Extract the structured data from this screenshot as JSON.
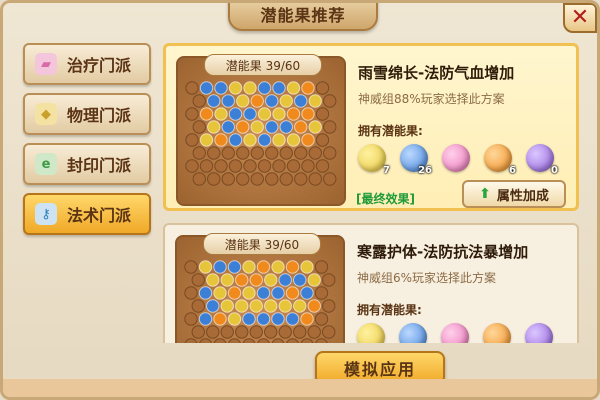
{
  "window": {
    "title": "潜能果推荐",
    "close_label": "✕"
  },
  "sidebar": {
    "items": [
      {
        "label": "治疗门派",
        "icon": "heal-scroll-icon",
        "color": "#d86aa8",
        "active": false
      },
      {
        "label": "物理门派",
        "icon": "physical-emblem-icon",
        "color": "#c9a02a",
        "active": false
      },
      {
        "label": "封印门派",
        "icon": "seal-emblem-icon",
        "color": "#3f9a48",
        "active": false
      },
      {
        "label": "法术门派",
        "icon": "magic-key-icon",
        "color": "#2b7fb8",
        "active": true
      }
    ]
  },
  "cards": [
    {
      "board_label": "潜能果 39/60",
      "title": "雨雪绵长-法防气血增加",
      "subtitle": "神威组88%玩家选择此方案",
      "own_label": "拥有潜能果:",
      "fruits": [
        {
          "icon": "gold-fruit-icon",
          "color": "#e7c53a",
          "count": "7"
        },
        {
          "icon": "blue-fruit-icon",
          "color": "#3c7fd6",
          "count": "26"
        },
        {
          "icon": "pink-fruit-icon",
          "color": "#e86fb4",
          "count": ""
        },
        {
          "icon": "orange-fruit-icon",
          "color": "#f08a1c",
          "count": "6"
        },
        {
          "icon": "purple-fruit-icon",
          "color": "#8d5bd8",
          "count": "0"
        }
      ],
      "final_tag": "[最终效果]",
      "attr_button": "属性加成"
    },
    {
      "board_label": "潜能果 39/60",
      "title": "寒露护体-法防抗法暴增加",
      "subtitle": "神威组6%玩家选择此方案",
      "own_label": "拥有潜能果:"
    }
  ],
  "bottom_button": "模拟应用"
}
